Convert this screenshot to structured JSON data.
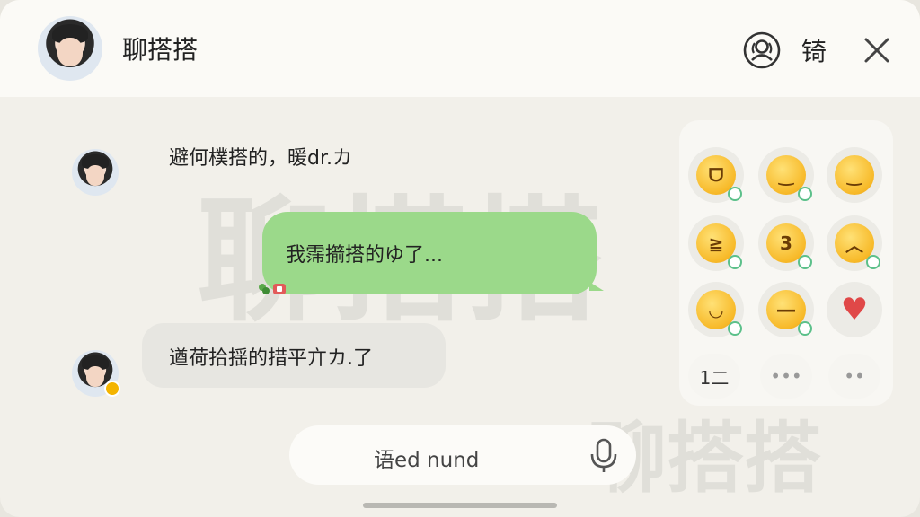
{
  "header": {
    "title": "聊搭搭",
    "action_text": "锜"
  },
  "watermarks": {
    "large": "聊搭搭",
    "bottom": "聊搭搭"
  },
  "messages": [
    {
      "side": "left",
      "text": "避何樸搭的，暖dr.カ"
    },
    {
      "side": "right",
      "text": "我霈擶搭的ゆ了..."
    },
    {
      "side": "left",
      "text": "遒荷拾揺的措平亣カ.了"
    }
  ],
  "emoji_panel": {
    "emojis": [
      "grinning",
      "smirk",
      "smile",
      "laughing",
      "kiss",
      "wince",
      "squint",
      "unamused",
      "heart"
    ],
    "buttons": [
      "1二",
      "•••",
      "••"
    ]
  },
  "input": {
    "placeholder": "语ed nund"
  },
  "colors": {
    "bubble_green": "#9bd98a",
    "bubble_gray": "#e7e6e1",
    "background": "#f2f0ea"
  }
}
